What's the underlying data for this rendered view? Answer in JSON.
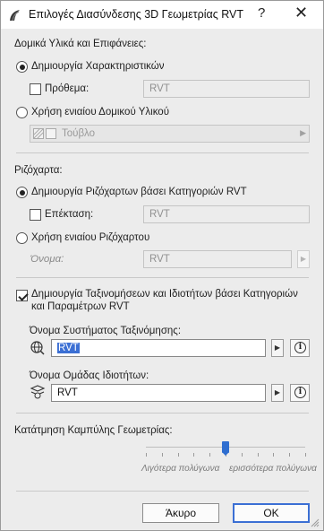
{
  "window": {
    "title": "Επιλογές Διασύνδεσης 3D Γεωμετρίας RVT",
    "help_label": "?",
    "close_label": "✕"
  },
  "materials": {
    "heading": "Δομικά Υλικά και Επιφάνειες:",
    "create_attributes_label": "Δημιουργία Χαρακτηριστικών",
    "create_attributes_selected": true,
    "prefix_label": "Πρόθεμα:",
    "prefix_checked": false,
    "prefix_value": "RVT",
    "use_single_label": "Χρήση ενιαίου Δομικού Υλικού",
    "use_single_selected": false,
    "single_material_value": "Τούβλο"
  },
  "layers": {
    "heading": "Ριζόχαρτα:",
    "create_by_category_label": "Δημιουργία Ριζόχαρτων βάσει Κατηγοριών RVT",
    "create_by_category_selected": true,
    "extension_label": "Επέκταση:",
    "extension_checked": false,
    "extension_value": "RVT",
    "use_single_label": "Χρήση ενιαίου Ριζόχαρτου",
    "use_single_selected": false,
    "name_label": "Όνομα:",
    "name_value": "RVT"
  },
  "classification": {
    "checkbox_label_line1": "Δημιουργία Ταξινομήσεων και Ιδιοτήτων βάσει Κατηγοριών",
    "checkbox_label_line2": "και Παραμέτρων RVT",
    "checked": true,
    "system_name_label": "Όνομα Συστήματος Ταξινόμησης:",
    "system_name_value": "RVT",
    "property_group_label": "Όνομα Ομάδας Ιδιοτήτων:",
    "property_group_value": "RVT"
  },
  "curve": {
    "heading": "Κατάτμηση Καμπύλης Γεωμετρίας:",
    "fewer_label": "Λιγότερα πολύγωνα",
    "more_label": "ερισσότερα πολύγωνα",
    "slider_fraction": 0.5
  },
  "footer": {
    "cancel_label": "Άκυρο",
    "ok_label": "OK"
  },
  "colors": {
    "accent": "#3b6fd4",
    "slider": "#2f6ed0"
  }
}
